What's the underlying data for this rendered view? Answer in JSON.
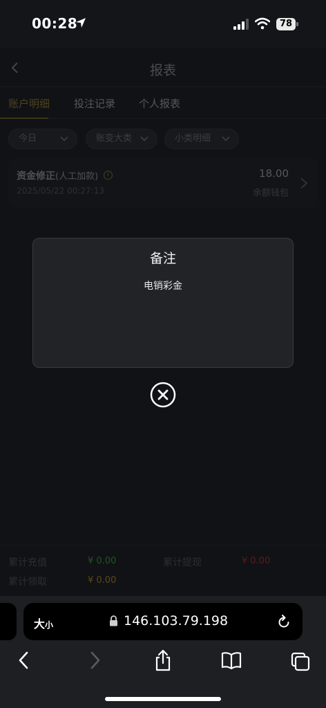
{
  "status_bar": {
    "time": "00:28",
    "battery": "78"
  },
  "app": {
    "title": "报表",
    "tabs": [
      "账户明细",
      "投注记录",
      "个人报表"
    ],
    "filters": [
      "今日",
      "账变大类",
      "小类明细"
    ],
    "record": {
      "title": "资金修正",
      "subtitle": "(人工加款)",
      "time": "2025/05/22 00:27:13",
      "amount": "18.00",
      "wallet": "余额钱包"
    },
    "summary": {
      "recharge_label": "累计充值",
      "recharge_value": "¥ 0.00",
      "withdraw_label": "累计提现",
      "withdraw_value": "¥ 0.00",
      "receive_label": "累计领取",
      "receive_value": "¥ 0.00"
    }
  },
  "modal": {
    "title": "备注",
    "body": "电销彩金"
  },
  "browser": {
    "aa_big": "大",
    "aa_small": "小",
    "url": "146.103.79.198"
  },
  "colors": {
    "accent_gold": "#8a7233",
    "green": "#1f8a2e",
    "red": "#8a1f1f",
    "modal_bg": "#222327"
  }
}
